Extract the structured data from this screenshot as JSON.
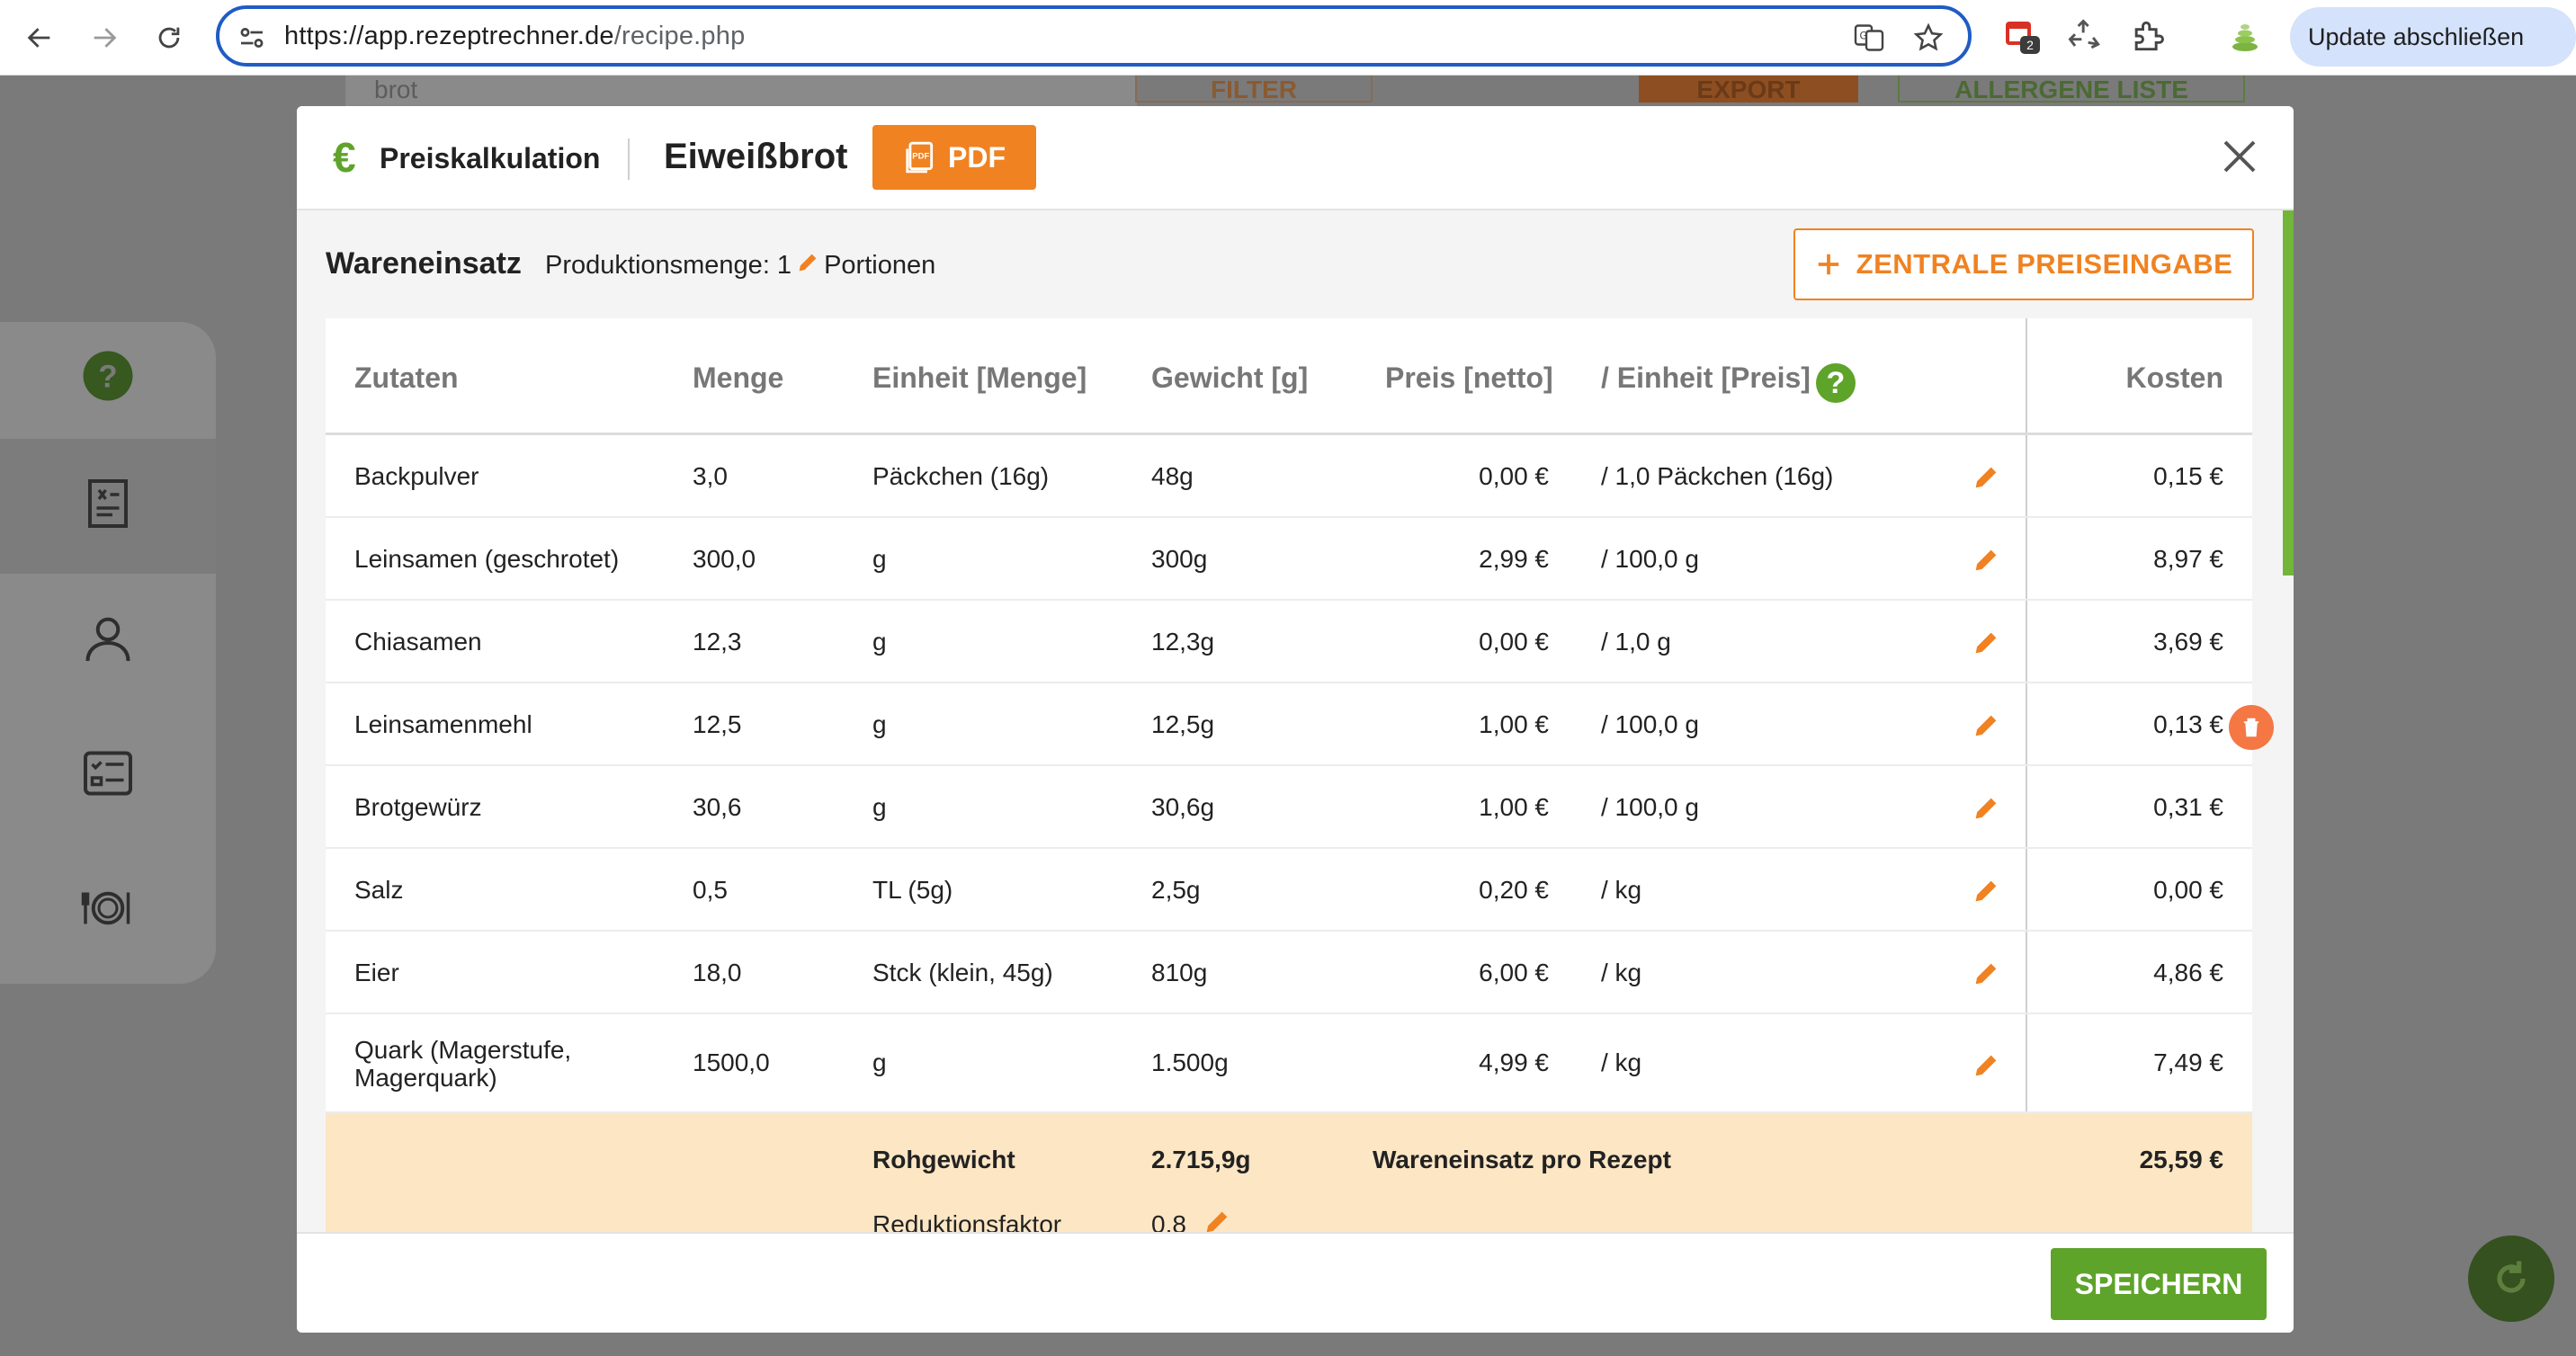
{
  "browser": {
    "url_host": "https://app.rezeptrechner.de",
    "url_path": "/recipe.php",
    "ext_badge": "2",
    "update_label": "Update abschließen"
  },
  "background": {
    "search_value": "brot",
    "filter_label": "FILTER",
    "export_label": "EXPORT",
    "allergen_label": "ALLERGENE LISTE"
  },
  "modal": {
    "currency_symbol": "€",
    "title": "Preiskalkulation",
    "recipe_name": "Eiweißbrot",
    "pdf_label": "PDF",
    "section_title": "Wareneinsatz",
    "production_label": "Produktionsmenge: 1",
    "production_unit": "Portionen",
    "central_price_label": "ZENTRALE PREISEINGABE",
    "help_symbol": "?",
    "save_label": "SPEICHERN"
  },
  "table": {
    "headers": {
      "ingredient": "Zutaten",
      "amount": "Menge",
      "unit_amount": "Einheit [Menge]",
      "weight": "Gewicht [g]",
      "price": "Preis [netto]",
      "unit_price": "/ Einheit [Preis]",
      "cost": "Kosten"
    },
    "rows": [
      {
        "ingredient": "Backpulver",
        "amount": "3,0",
        "unit": "Päckchen (16g)",
        "weight": "48g",
        "price": "0,00 €",
        "price_unit": "/ 1,0 Päckchen (16g)",
        "cost": "0,15 €"
      },
      {
        "ingredient": "Leinsamen (geschrotet)",
        "amount": "300,0",
        "unit": "g",
        "weight": "300g",
        "price": "2,99 €",
        "price_unit": "/ 100,0 g",
        "cost": "8,97 €"
      },
      {
        "ingredient": "Chiasamen",
        "amount": "12,3",
        "unit": "g",
        "weight": "12,3g",
        "price": "0,00 €",
        "price_unit": "/ 1,0 g",
        "cost": "3,69 €"
      },
      {
        "ingredient": "Leinsamenmehl",
        "amount": "12,5",
        "unit": "g",
        "weight": "12,5g",
        "price": "1,00 €",
        "price_unit": "/ 100,0 g",
        "cost": "0,13 €"
      },
      {
        "ingredient": "Brotgewürz",
        "amount": "30,6",
        "unit": "g",
        "weight": "30,6g",
        "price": "1,00 €",
        "price_unit": "/ 100,0 g",
        "cost": "0,31 €"
      },
      {
        "ingredient": "Salz",
        "amount": "0,5",
        "unit": "TL (5g)",
        "weight": "2,5g",
        "price": "0,20 €",
        "price_unit": "/ kg",
        "cost": "0,00 €"
      },
      {
        "ingredient": "Eier",
        "amount": "18,0",
        "unit": "Stck (klein, 45g)",
        "weight": "810g",
        "price": "6,00 €",
        "price_unit": "/ kg",
        "cost": "4,86 €"
      },
      {
        "ingredient": "Quark (Magerstufe, Magerquark)",
        "amount": "1500,0",
        "unit": "g",
        "weight": "1.500g",
        "price": "4,99 €",
        "price_unit": "/ kg",
        "cost": "7,49 €"
      }
    ],
    "summary": {
      "raw_weight_label": "Rohgewicht",
      "raw_weight_value": "2.715,9g",
      "cost_per_recipe_label": "Wareneinsatz pro Rezept",
      "cost_per_recipe_value": "25,59 €",
      "reduction_label": "Reduktionsfaktor",
      "reduction_value": "0,8"
    }
  },
  "colors": {
    "orange": "#f08221",
    "green": "#5ea32a",
    "summary_bg": "#fde6c4"
  }
}
